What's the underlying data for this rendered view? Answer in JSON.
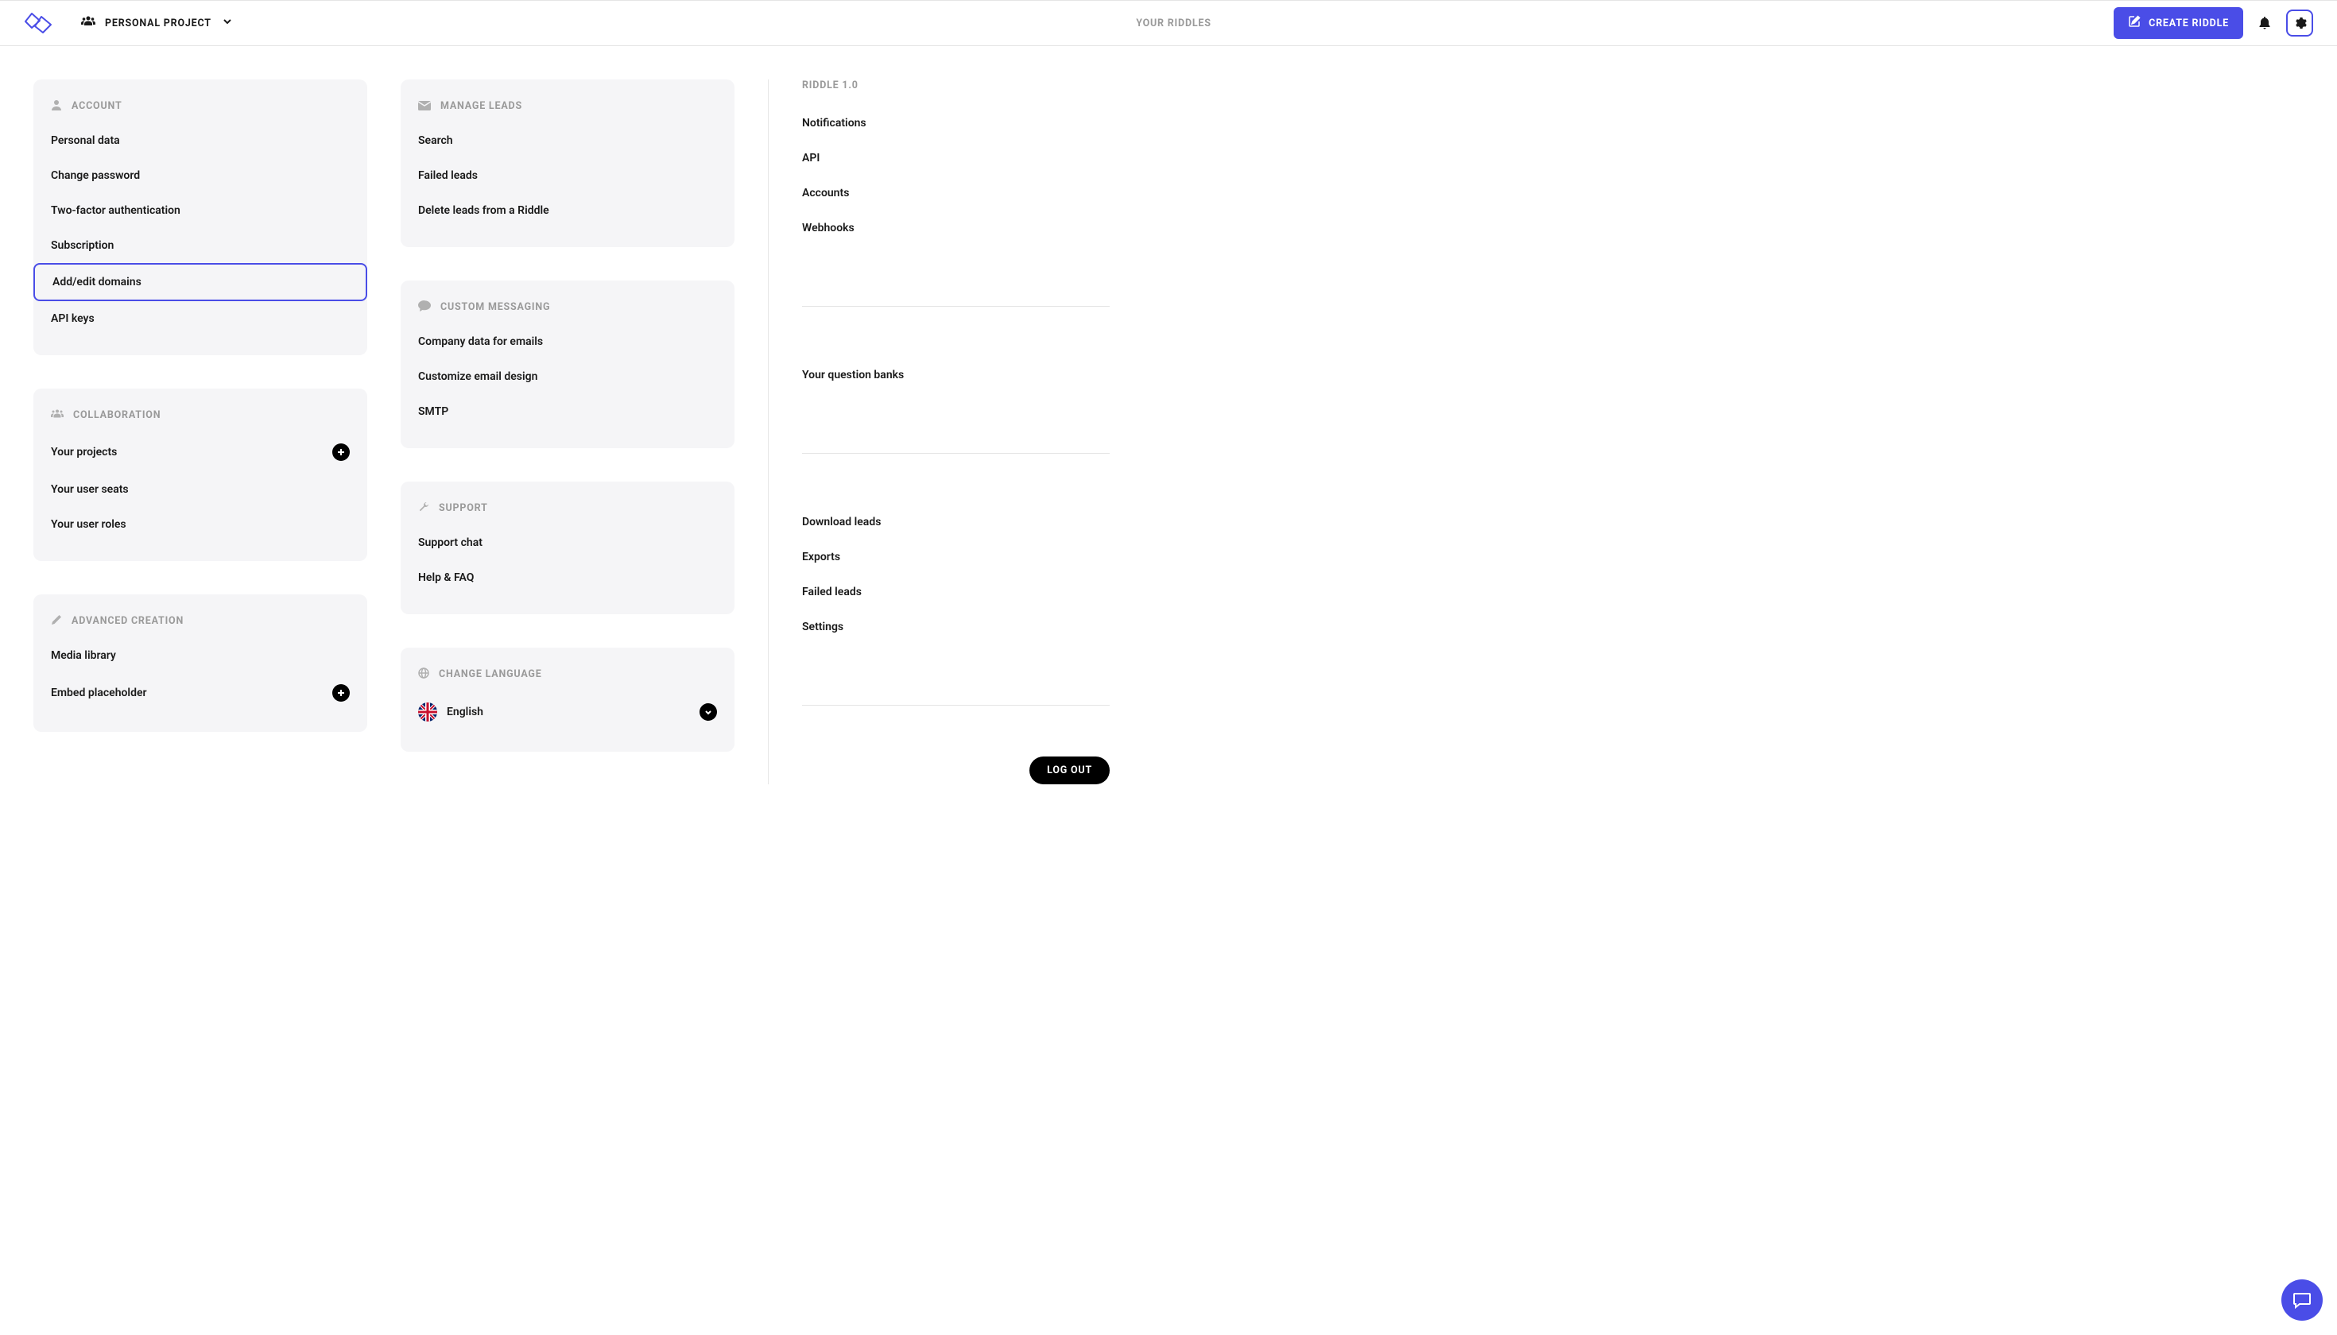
{
  "header": {
    "project_label": "PERSONAL PROJECT",
    "center_title": "YOUR RIDDLES",
    "create_button": "CREATE RIDDLE"
  },
  "cards": {
    "account": {
      "title": "ACCOUNT",
      "items": [
        "Personal data",
        "Change password",
        "Two-factor authentication",
        "Subscription",
        "Add/edit domains",
        "API keys"
      ],
      "selected_index": 4
    },
    "collaboration": {
      "title": "COLLABORATION",
      "items": [
        "Your projects",
        "Your user seats",
        "Your user roles"
      ],
      "plus_index": 0
    },
    "advanced": {
      "title": "ADVANCED CREATION",
      "items": [
        "Media library",
        "Embed placeholder"
      ],
      "plus_index": 1
    },
    "leads": {
      "title": "MANAGE LEADS",
      "items": [
        "Search",
        "Failed leads",
        "Delete leads from a Riddle"
      ]
    },
    "messaging": {
      "title": "CUSTOM MESSAGING",
      "items": [
        "Company data for emails",
        "Customize email design",
        "SMTP"
      ]
    },
    "support": {
      "title": "SUPPORT",
      "items": [
        "Support chat",
        "Help & FAQ"
      ]
    },
    "language": {
      "title": "CHANGE LANGUAGE",
      "selected": "English"
    }
  },
  "sidebar": {
    "riddle10_title": "RIDDLE 1.0",
    "riddle10_items": [
      "Notifications",
      "API",
      "Accounts",
      "Webhooks"
    ],
    "qbank_item": "Your question banks",
    "other_items": [
      "Download leads",
      "Exports",
      "Failed leads",
      "Settings"
    ],
    "logout": "LOG OUT"
  }
}
